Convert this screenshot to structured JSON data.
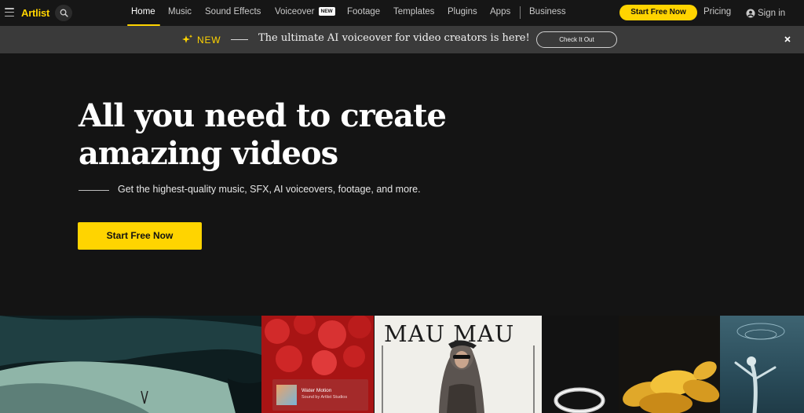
{
  "nav": {
    "logo": "Artlist",
    "items": [
      {
        "label": "Home",
        "active": true
      },
      {
        "label": "Music"
      },
      {
        "label": "Sound Effects"
      },
      {
        "label": "Voiceover",
        "badge": "NEW"
      },
      {
        "label": "Footage"
      },
      {
        "label": "Templates"
      },
      {
        "label": "Plugins"
      },
      {
        "label": "Apps"
      },
      {
        "label": "Business"
      }
    ],
    "cta": "Start Free Now",
    "pricing": "Pricing",
    "signin": "Sign in",
    "icons": [
      "hamburger-icon",
      "search-icon",
      "user-icon"
    ]
  },
  "banner": {
    "new_label": "NEW",
    "text": "The ultimate AI voiceover for video creators is here!",
    "button": "Check It Out",
    "icons": [
      "sparkle-icon",
      "close-icon"
    ]
  },
  "hero": {
    "title_line1": "All you need to create",
    "title_line2": "amazing videos",
    "subtitle": "Get the highest-quality music, SFX, AI voiceovers, footage, and more.",
    "cta": "Start Free Now"
  },
  "gallery": {
    "mau_title": "MAU MAU",
    "track_card": {
      "title": "Water Motion",
      "subtitle": "Sound by Artlist Studios"
    }
  },
  "colors": {
    "accent": "#ffd400",
    "background": "#141414",
    "nav_bg": "#161616",
    "banner_bg": "#3a3a3a"
  }
}
